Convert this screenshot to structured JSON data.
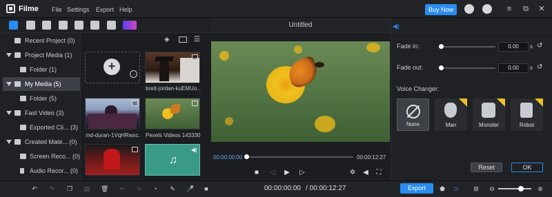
{
  "app": {
    "name": "Filme",
    "buy_now": "Buy Now"
  },
  "menu": [
    "File",
    "Settings",
    "Export",
    "Help"
  ],
  "preview": {
    "title": "Untitled",
    "time_current": "00:00:00:00",
    "time_total": "00:00:12:27"
  },
  "sidebar": {
    "items": [
      {
        "label": "Recent Project (0)"
      },
      {
        "label": "Project Media (1)"
      },
      {
        "label": "Folder (1)"
      },
      {
        "label": "My Media (5)"
      },
      {
        "label": "Folder (5)"
      },
      {
        "label": "Fast Video (3)"
      },
      {
        "label": "Exported Cli... (3)"
      },
      {
        "label": "Created Mate... (0)"
      },
      {
        "label": "Screen Reco... (0)"
      },
      {
        "label": "Audio Recor... (0)"
      }
    ]
  },
  "media": {
    "items": [
      {
        "label": "brett-jordan-kuEMUo..."
      },
      {
        "label": "md-duran-1VqHRwxc..."
      },
      {
        "label": "Pexels Videos 1433307"
      },
      {
        "label": ""
      },
      {
        "label": ""
      }
    ]
  },
  "audio": {
    "fade_in_label": "Fade in:",
    "fade_in_value": "0.00",
    "fade_out_label": "Fade out:",
    "fade_out_value": "0.00",
    "unit": "s",
    "voice_changer_label": "Voice Changer:",
    "voices": [
      "None",
      "Man",
      "Monster",
      "Robot"
    ],
    "reset": "Reset",
    "ok": "OK"
  },
  "bottom": {
    "time_current": "00:00:00:00",
    "time_total": "/ 00:00:12:27",
    "export": "Export"
  }
}
